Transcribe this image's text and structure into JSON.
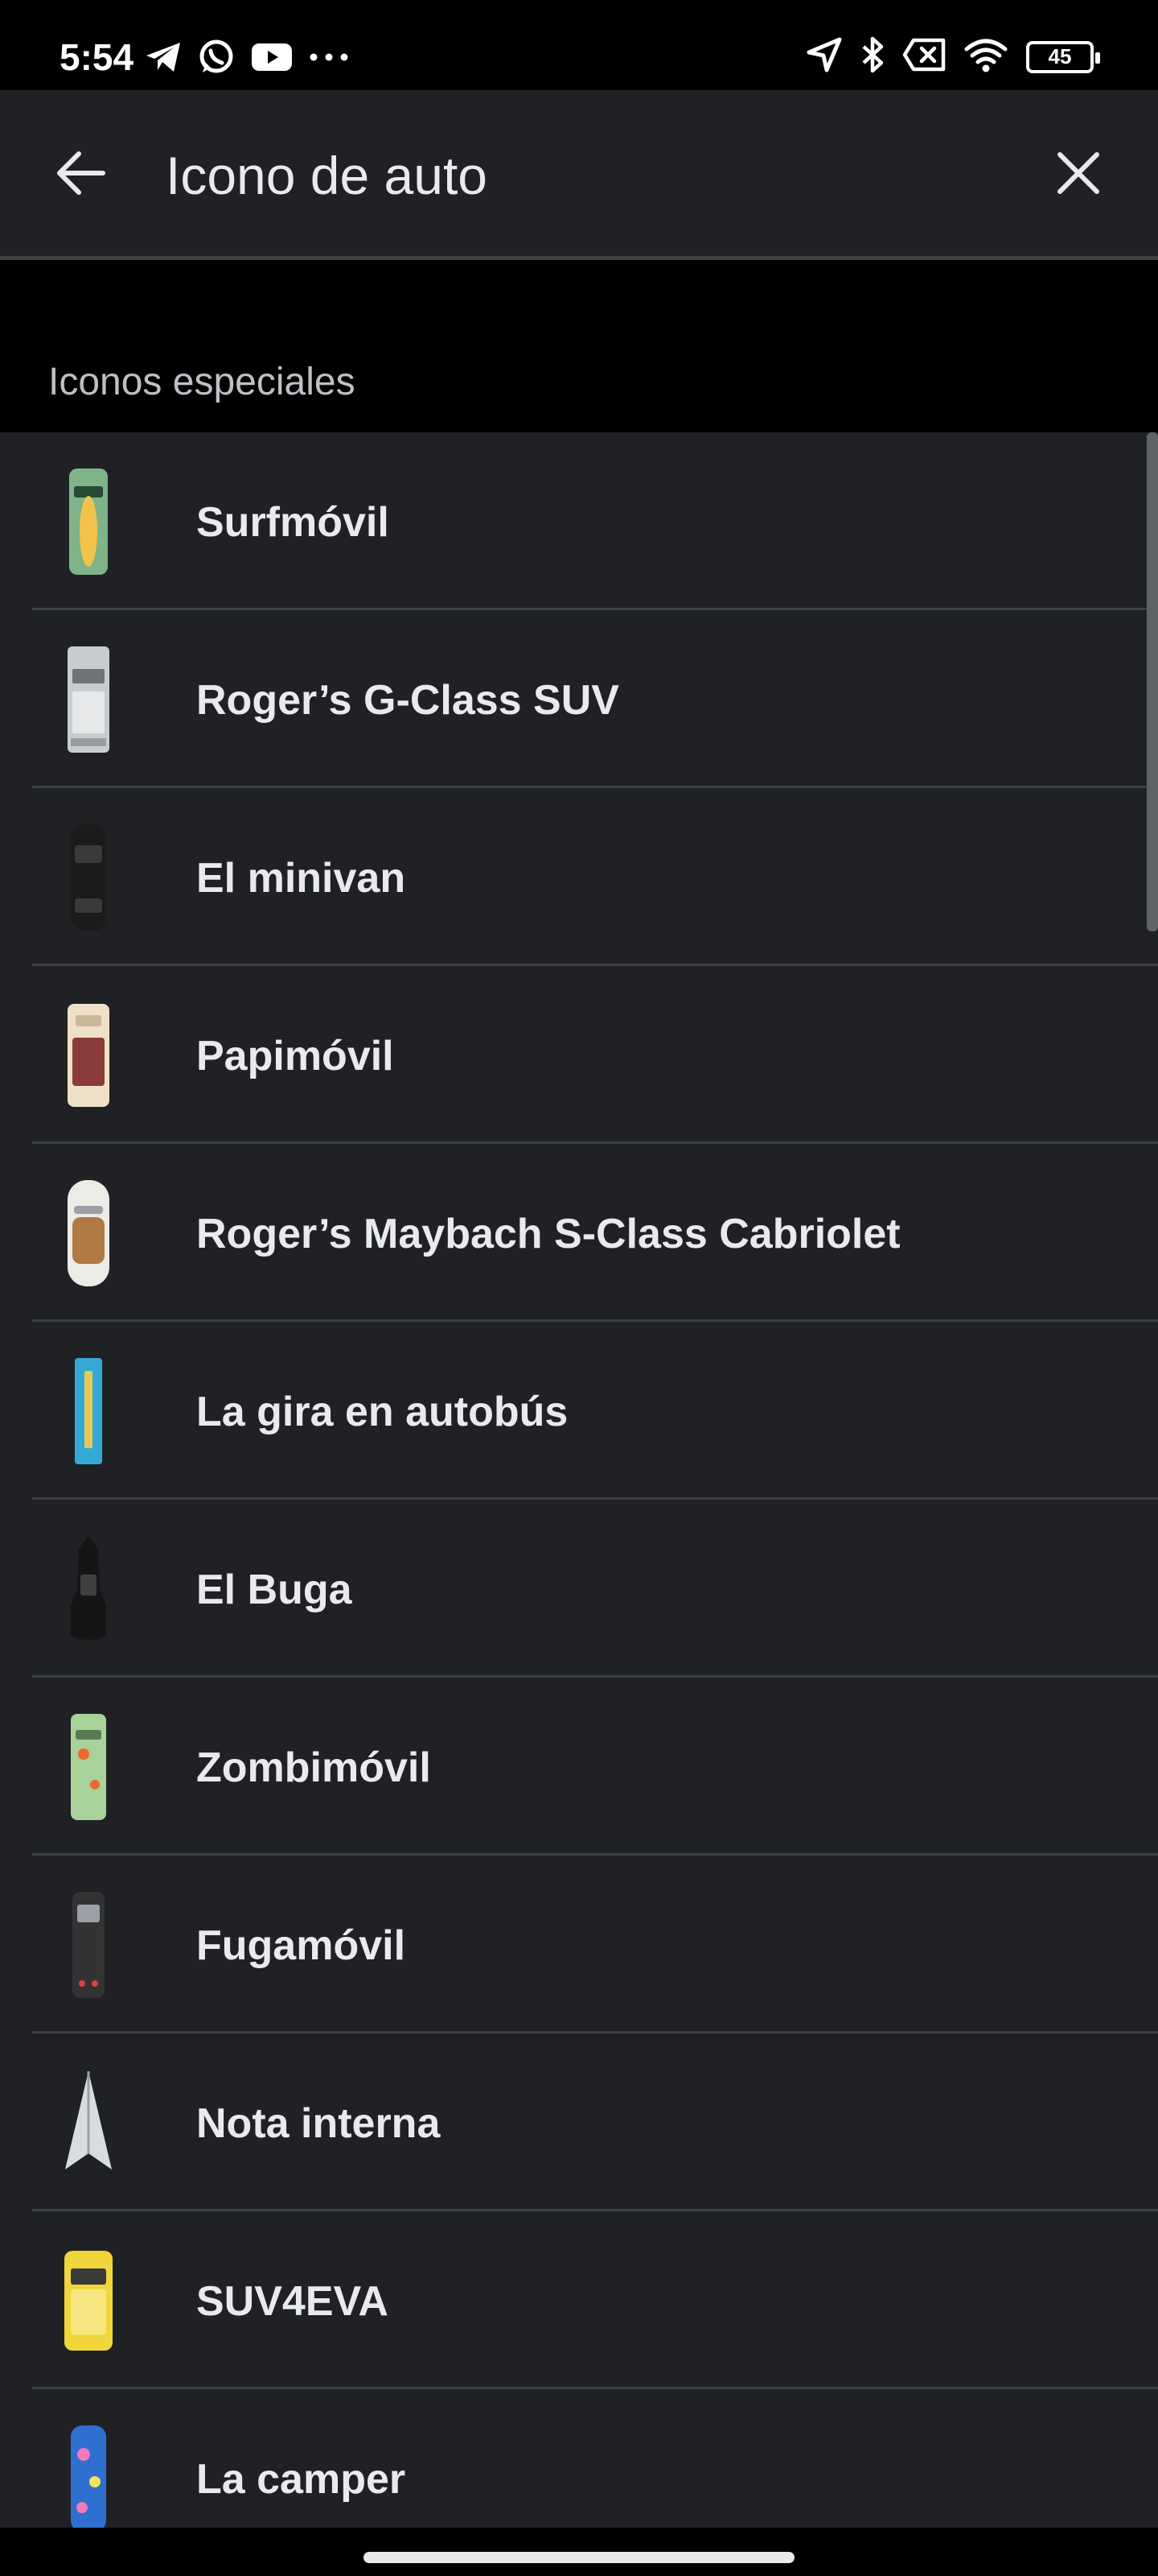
{
  "status_bar": {
    "time": "5:54",
    "battery": "45",
    "left_icons": [
      "telegram-icon",
      "whatsapp-icon",
      "youtube-icon",
      "more-icon"
    ],
    "right_icons": [
      "location-icon",
      "bluetooth-icon",
      "no-sim-icon",
      "wifi-icon",
      "battery-icon"
    ]
  },
  "app_bar": {
    "title": "Icono de auto",
    "back_icon": "arrow-back-icon",
    "close_icon": "close-icon"
  },
  "section": {
    "label": "Iconos especiales"
  },
  "vehicles": [
    {
      "label": "Surfmóvil",
      "icon": "surf-car-icon",
      "body_color": "#7fb48a",
      "accent_color": "#f2c24a"
    },
    {
      "label": "Roger’s G-Class SUV",
      "icon": "g-class-suv-icon",
      "body_color": "#c9cccf",
      "accent_color": "#6f7377"
    },
    {
      "label": "El minivan",
      "icon": "minivan-icon",
      "body_color": "#1b1b1b",
      "accent_color": "#3a3a3a"
    },
    {
      "label": "Papimóvil",
      "icon": "papimovil-icon",
      "body_color": "#efe0c8",
      "accent_color": "#8a3b3b"
    },
    {
      "label": "Roger’s Maybach S-Class Cabriolet",
      "icon": "maybach-cabriolet-icon",
      "body_color": "#ecebe6",
      "accent_color": "#b07a44"
    },
    {
      "label": "La gira en autobús",
      "icon": "tour-bus-icon",
      "body_color": "#35a9d6",
      "accent_color": "#e6c85a"
    },
    {
      "label": "El Buga",
      "icon": "buga-icon",
      "body_color": "#151515",
      "accent_color": "#404040"
    },
    {
      "label": "Zombimóvil",
      "icon": "zombie-car-icon",
      "body_color": "#a7d29a",
      "accent_color": "#e86a2e"
    },
    {
      "label": "Fugamóvil",
      "icon": "getaway-car-icon",
      "body_color": "#333333",
      "accent_color": "#d9433a"
    },
    {
      "label": "Nota interna",
      "icon": "paper-plane-icon",
      "body_color": "#d8dcdf",
      "accent_color": "#9aa0a6"
    },
    {
      "label": "SUV4EVA",
      "icon": "suv4eva-icon",
      "body_color": "#f0d63a",
      "accent_color": "#3a3a3a"
    },
    {
      "label": "La camper",
      "icon": "camper-icon",
      "body_color": "#2f6fd0",
      "accent_color": "#f07bb8"
    }
  ]
}
